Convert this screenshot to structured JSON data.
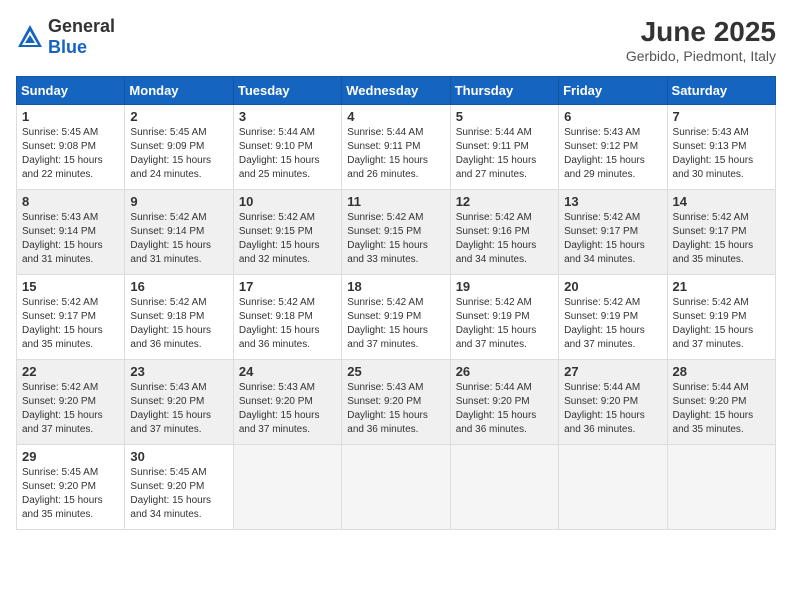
{
  "header": {
    "logo_general": "General",
    "logo_blue": "Blue",
    "month_title": "June 2025",
    "location": "Gerbido, Piedmont, Italy"
  },
  "calendar": {
    "days_of_week": [
      "Sunday",
      "Monday",
      "Tuesday",
      "Wednesday",
      "Thursday",
      "Friday",
      "Saturday"
    ],
    "weeks": [
      [
        null,
        {
          "day": "2",
          "sunrise": "Sunrise: 5:45 AM",
          "sunset": "Sunset: 9:09 PM",
          "daylight": "Daylight: 15 hours and 24 minutes."
        },
        {
          "day": "3",
          "sunrise": "Sunrise: 5:44 AM",
          "sunset": "Sunset: 9:10 PM",
          "daylight": "Daylight: 15 hours and 25 minutes."
        },
        {
          "day": "4",
          "sunrise": "Sunrise: 5:44 AM",
          "sunset": "Sunset: 9:11 PM",
          "daylight": "Daylight: 15 hours and 26 minutes."
        },
        {
          "day": "5",
          "sunrise": "Sunrise: 5:44 AM",
          "sunset": "Sunset: 9:11 PM",
          "daylight": "Daylight: 15 hours and 27 minutes."
        },
        {
          "day": "6",
          "sunrise": "Sunrise: 5:43 AM",
          "sunset": "Sunset: 9:12 PM",
          "daylight": "Daylight: 15 hours and 29 minutes."
        },
        {
          "day": "7",
          "sunrise": "Sunrise: 5:43 AM",
          "sunset": "Sunset: 9:13 PM",
          "daylight": "Daylight: 15 hours and 30 minutes."
        }
      ],
      [
        {
          "day": "1",
          "sunrise": "Sunrise: 5:45 AM",
          "sunset": "Sunset: 9:08 PM",
          "daylight": "Daylight: 15 hours and 22 minutes."
        },
        {
          "day": "8",
          "sunrise": "Sunrise: 5:43 AM",
          "sunset": "Sunset: 9:14 PM",
          "daylight": "Daylight: 15 hours and 31 minutes."
        },
        {
          "day": "9",
          "sunrise": "Sunrise: 5:42 AM",
          "sunset": "Sunset: 9:14 PM",
          "daylight": "Daylight: 15 hours and 31 minutes."
        },
        {
          "day": "10",
          "sunrise": "Sunrise: 5:42 AM",
          "sunset": "Sunset: 9:15 PM",
          "daylight": "Daylight: 15 hours and 32 minutes."
        },
        {
          "day": "11",
          "sunrise": "Sunrise: 5:42 AM",
          "sunset": "Sunset: 9:15 PM",
          "daylight": "Daylight: 15 hours and 33 minutes."
        },
        {
          "day": "12",
          "sunrise": "Sunrise: 5:42 AM",
          "sunset": "Sunset: 9:16 PM",
          "daylight": "Daylight: 15 hours and 34 minutes."
        },
        {
          "day": "13",
          "sunrise": "Sunrise: 5:42 AM",
          "sunset": "Sunset: 9:17 PM",
          "daylight": "Daylight: 15 hours and 34 minutes."
        },
        {
          "day": "14",
          "sunrise": "Sunrise: 5:42 AM",
          "sunset": "Sunset: 9:17 PM",
          "daylight": "Daylight: 15 hours and 35 minutes."
        }
      ],
      [
        {
          "day": "15",
          "sunrise": "Sunrise: 5:42 AM",
          "sunset": "Sunset: 9:17 PM",
          "daylight": "Daylight: 15 hours and 35 minutes."
        },
        {
          "day": "16",
          "sunrise": "Sunrise: 5:42 AM",
          "sunset": "Sunset: 9:18 PM",
          "daylight": "Daylight: 15 hours and 36 minutes."
        },
        {
          "day": "17",
          "sunrise": "Sunrise: 5:42 AM",
          "sunset": "Sunset: 9:18 PM",
          "daylight": "Daylight: 15 hours and 36 minutes."
        },
        {
          "day": "18",
          "sunrise": "Sunrise: 5:42 AM",
          "sunset": "Sunset: 9:19 PM",
          "daylight": "Daylight: 15 hours and 37 minutes."
        },
        {
          "day": "19",
          "sunrise": "Sunrise: 5:42 AM",
          "sunset": "Sunset: 9:19 PM",
          "daylight": "Daylight: 15 hours and 37 minutes."
        },
        {
          "day": "20",
          "sunrise": "Sunrise: 5:42 AM",
          "sunset": "Sunset: 9:19 PM",
          "daylight": "Daylight: 15 hours and 37 minutes."
        },
        {
          "day": "21",
          "sunrise": "Sunrise: 5:42 AM",
          "sunset": "Sunset: 9:19 PM",
          "daylight": "Daylight: 15 hours and 37 minutes."
        }
      ],
      [
        {
          "day": "22",
          "sunrise": "Sunrise: 5:42 AM",
          "sunset": "Sunset: 9:20 PM",
          "daylight": "Daylight: 15 hours and 37 minutes."
        },
        {
          "day": "23",
          "sunrise": "Sunrise: 5:43 AM",
          "sunset": "Sunset: 9:20 PM",
          "daylight": "Daylight: 15 hours and 37 minutes."
        },
        {
          "day": "24",
          "sunrise": "Sunrise: 5:43 AM",
          "sunset": "Sunset: 9:20 PM",
          "daylight": "Daylight: 15 hours and 37 minutes."
        },
        {
          "day": "25",
          "sunrise": "Sunrise: 5:43 AM",
          "sunset": "Sunset: 9:20 PM",
          "daylight": "Daylight: 15 hours and 36 minutes."
        },
        {
          "day": "26",
          "sunrise": "Sunrise: 5:44 AM",
          "sunset": "Sunset: 9:20 PM",
          "daylight": "Daylight: 15 hours and 36 minutes."
        },
        {
          "day": "27",
          "sunrise": "Sunrise: 5:44 AM",
          "sunset": "Sunset: 9:20 PM",
          "daylight": "Daylight: 15 hours and 36 minutes."
        },
        {
          "day": "28",
          "sunrise": "Sunrise: 5:44 AM",
          "sunset": "Sunset: 9:20 PM",
          "daylight": "Daylight: 15 hours and 35 minutes."
        }
      ],
      [
        {
          "day": "29",
          "sunrise": "Sunrise: 5:45 AM",
          "sunset": "Sunset: 9:20 PM",
          "daylight": "Daylight: 15 hours and 35 minutes."
        },
        {
          "day": "30",
          "sunrise": "Sunrise: 5:45 AM",
          "sunset": "Sunset: 9:20 PM",
          "daylight": "Daylight: 15 hours and 34 minutes."
        },
        null,
        null,
        null,
        null,
        null
      ]
    ]
  }
}
